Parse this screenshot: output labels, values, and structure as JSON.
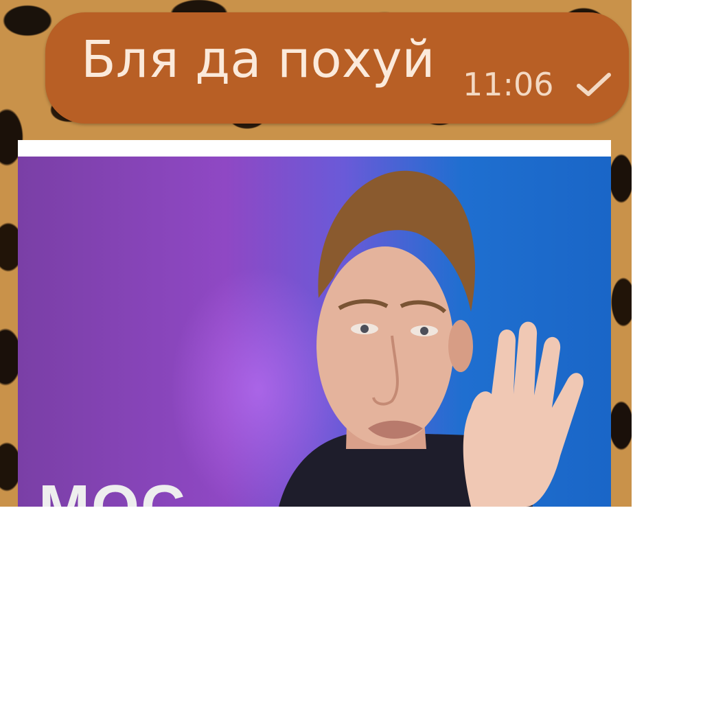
{
  "message": {
    "text": "Бля да похуй",
    "time": "11:06",
    "status_icon": "check-icon",
    "bubble_color": "#b85f25",
    "text_color": "#fbeadb"
  },
  "media": {
    "type": "video-thumbnail",
    "caption_fragment": "МОС"
  }
}
